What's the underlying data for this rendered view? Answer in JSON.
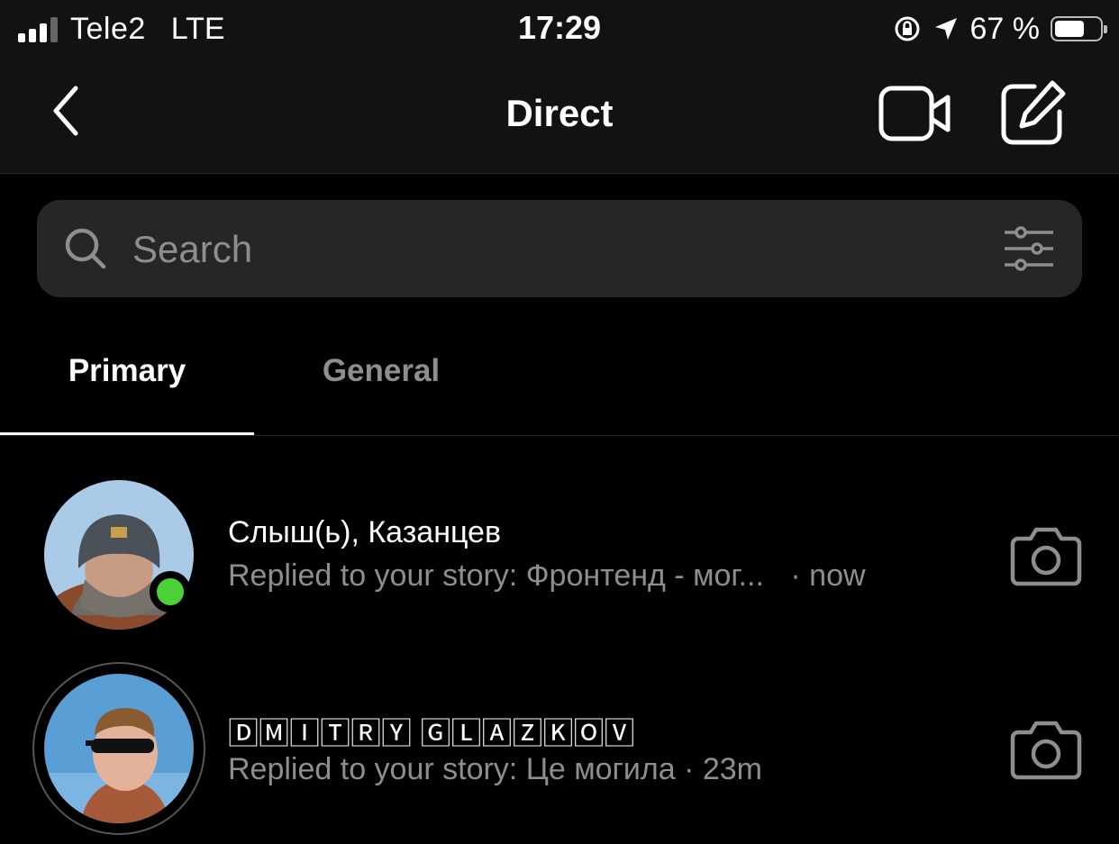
{
  "status_bar": {
    "carrier": "Tele2",
    "network": "LTE",
    "time": "17:29",
    "battery_percent": "67 %",
    "battery_level": 0.67,
    "icons": [
      "signal-icon",
      "orientation-lock-icon",
      "location-arrow-icon",
      "battery-icon"
    ]
  },
  "nav": {
    "title": "Direct",
    "icons": [
      "back-chevron-icon",
      "video-camera-icon",
      "compose-icon"
    ]
  },
  "search": {
    "placeholder": "Search",
    "icons": [
      "search-icon",
      "filter-sliders-icon"
    ]
  },
  "tabs": [
    {
      "label": "Primary",
      "selected": true
    },
    {
      "label": "General",
      "selected": false
    }
  ],
  "conversations": [
    {
      "name": "Слыш(ь), Казанцев",
      "preview": "Replied to your story: Фронтенд - мог...",
      "time": "· now",
      "online": true,
      "icon": "camera-icon"
    },
    {
      "name": "🄳🄼🄸🅃🅁🅈 🄶🄻🄰🅉🄺🄾🅅",
      "preview": "Replied to your story: Це могила",
      "time": "· 23m",
      "has_story_ring": true,
      "icon": "camera-icon"
    }
  ],
  "colors": {
    "background": "#000000",
    "bar_background": "#121212",
    "search_background": "#262626",
    "secondary_text": "#8e8e8e",
    "online_green": "#4cd137"
  }
}
